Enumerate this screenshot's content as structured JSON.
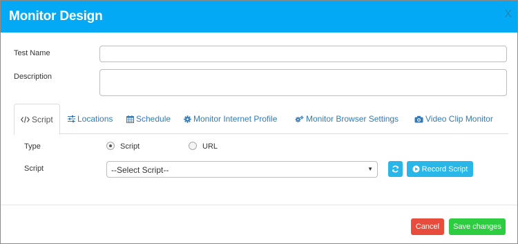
{
  "header": {
    "title": "Monitor Design",
    "close_label": "X"
  },
  "form": {
    "test_name_label": "Test Name",
    "test_name_value": "",
    "description_label": "Description",
    "description_value": ""
  },
  "tabs": [
    {
      "label": "Script",
      "icon": "code-icon",
      "active": true
    },
    {
      "label": "Locations",
      "icon": "sliders-icon",
      "active": false
    },
    {
      "label": "Schedule",
      "icon": "calendar-icon",
      "active": false
    },
    {
      "label": "Monitor Internet Profile",
      "icon": "gear-icon",
      "active": false
    },
    {
      "label": "Monitor Browser Settings",
      "icon": "gears-icon",
      "active": false
    },
    {
      "label": "Video Clip Monitor",
      "icon": "camera-icon",
      "active": false
    }
  ],
  "script_tab": {
    "type_label": "Type",
    "type_options": [
      {
        "label": "Script",
        "selected": true
      },
      {
        "label": "URL",
        "selected": false
      }
    ],
    "script_label": "Script",
    "script_select_value": "--Select Script--",
    "refresh_icon": "refresh-icon",
    "record_button_label": "Record Script",
    "record_icon": "play-circle-icon"
  },
  "footer": {
    "cancel_label": "Cancel",
    "save_label": "Save changes"
  },
  "colors": {
    "header": "#03a9f4",
    "link": "#337ab7",
    "info": "#29b6e8",
    "danger": "#e74c3c",
    "success": "#2ecc40"
  }
}
